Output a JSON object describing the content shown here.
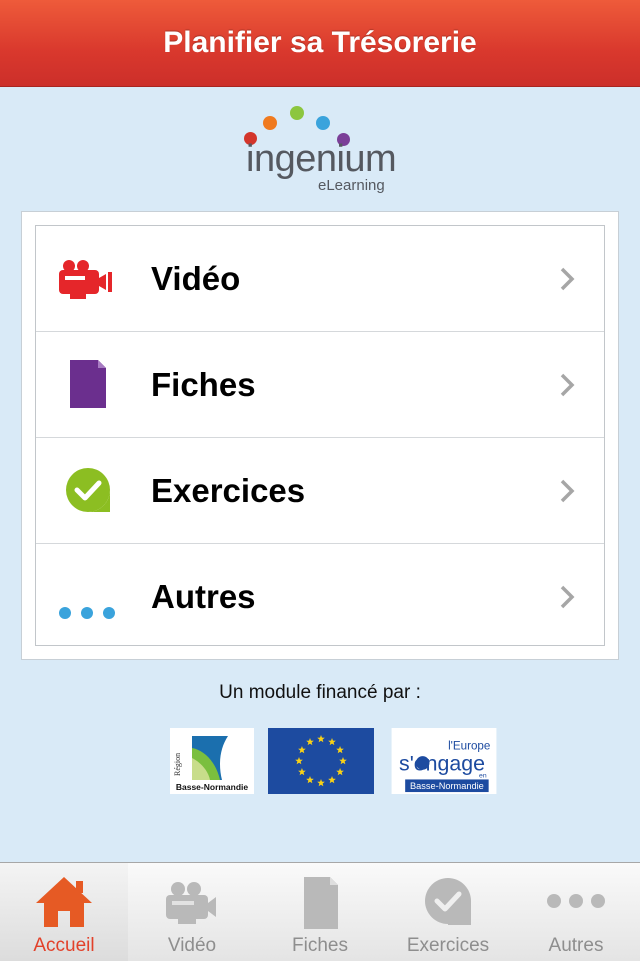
{
  "header": {
    "title": "Planifier sa Trésorerie"
  },
  "logo": {
    "word": "ingenium",
    "sub": "eLearning"
  },
  "menu": {
    "items": [
      {
        "label": "Vidéo",
        "icon": "video-camera-icon",
        "color": "#e5262a"
      },
      {
        "label": "Fiches",
        "icon": "document-icon",
        "color": "#6b2f8e"
      },
      {
        "label": "Exercices",
        "icon": "check-bubble-icon",
        "color": "#8cbe22"
      },
      {
        "label": "Autres",
        "icon": "more-dots-icon",
        "color": "#3aa3dc"
      }
    ]
  },
  "funding": {
    "text": "Un module financé par :",
    "sponsors": [
      {
        "name": "region-basse-normandie",
        "line1": "Région",
        "line2": "Basse-Normandie"
      },
      {
        "name": "european-union-flag"
      },
      {
        "name": "europe-s-engage",
        "line1": "l'Europe",
        "line2": "s'engage",
        "line3": "en",
        "line4": "Basse-Normandie"
      }
    ]
  },
  "tabbar": {
    "tabs": [
      {
        "label": "Accueil",
        "icon": "home-icon",
        "active": true
      },
      {
        "label": "Vidéo",
        "icon": "video-camera-icon"
      },
      {
        "label": "Fiches",
        "icon": "document-icon"
      },
      {
        "label": "Exercices",
        "icon": "check-bubble-icon"
      },
      {
        "label": "Autres",
        "icon": "more-dots-icon"
      }
    ]
  },
  "colors": {
    "header": "#dd3e2d",
    "background": "#d9eaf7",
    "active_tab": "#e2412a"
  }
}
